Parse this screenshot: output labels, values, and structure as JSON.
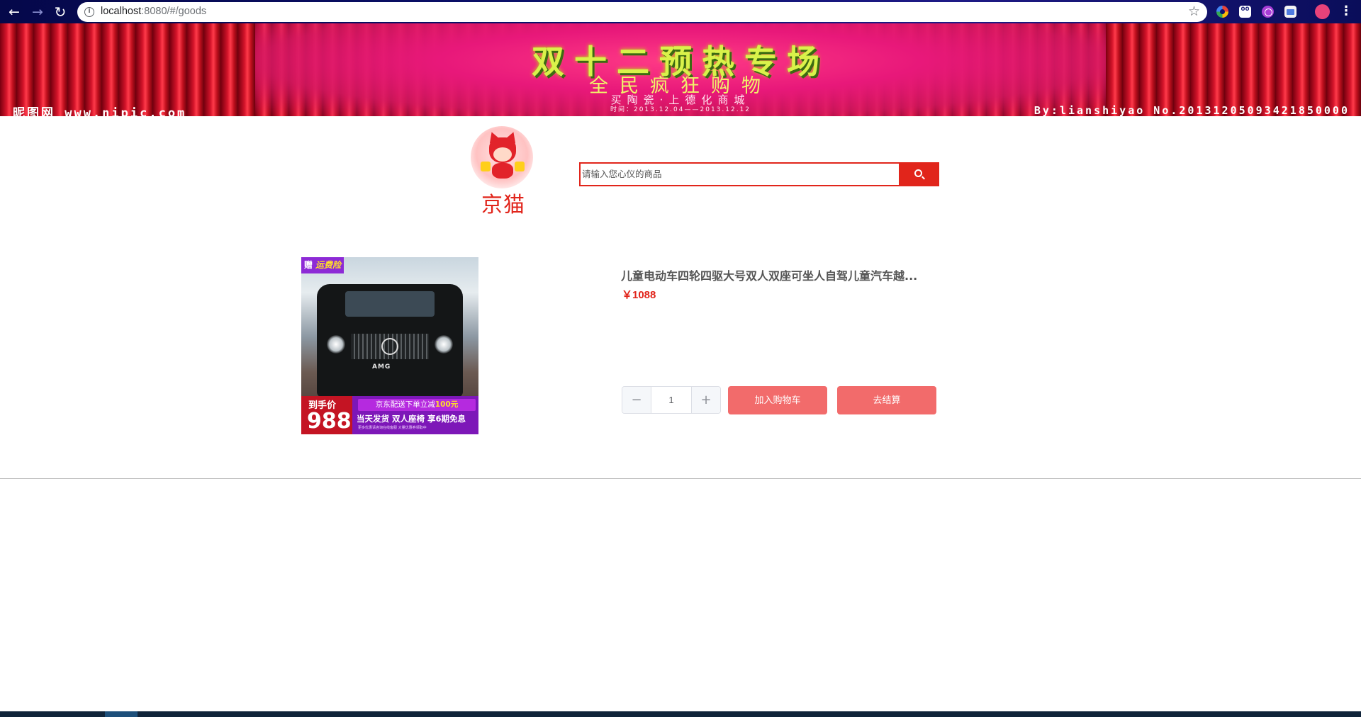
{
  "browser": {
    "url_host": "localhost",
    "url_rest": ":8080/#/goods",
    "icons": [
      "back-icon",
      "forward-icon",
      "reload-icon",
      "info-icon",
      "star-icon",
      "menu-dots-icon"
    ]
  },
  "banner": {
    "title": "双十二预热专场",
    "subtitle": "全民疯狂购物",
    "subtitle2": "买陶瓷·上德化商城",
    "date": "时间：2013.12.04——2013.12.12",
    "left_text": "昵图网 www.nipic.com",
    "right_text": "By:lianshiyao No.20131205093421850000"
  },
  "header": {
    "logo_text": "京猫",
    "search_placeholder": "请输入您心仪的商品"
  },
  "product": {
    "title": "儿童电动车四轮四驱大号双人双座可坐人自驾儿童汽车越...",
    "price": "￥1088",
    "quantity": "1",
    "image": {
      "gift_tag": "赠",
      "gift_tag_em": "运费险",
      "price_label": "到手价",
      "price_big": "988",
      "promo_prefix": "京东配送下单立减",
      "promo_amount": "100元",
      "desc": "当天发货 双人座椅 享6期免息",
      "fine": "更多优惠请咨询在线客服 大量优惠券领取中"
    }
  },
  "buttons": {
    "minus": "−",
    "plus": "+",
    "add_cart": "加入购物车",
    "checkout": "去结算"
  },
  "colors": {
    "brand_red": "#e1251b",
    "button_red": "#f26b6b",
    "title_gray": "#555555"
  }
}
